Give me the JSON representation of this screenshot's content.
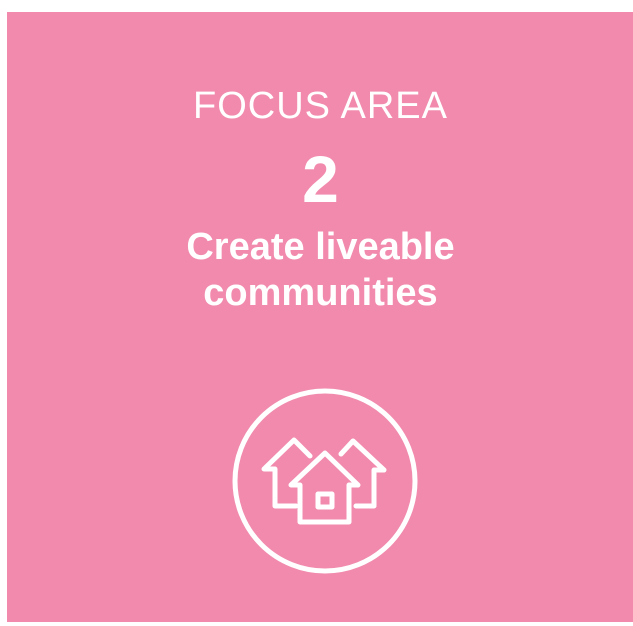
{
  "focus_area": {
    "eyebrow": "FOCUS AREA",
    "number": "2",
    "title_line1": "Create liveable",
    "title_line2": "communities"
  },
  "icon": {
    "name": "houses-icon"
  },
  "colors": {
    "background": "#f18aad",
    "foreground": "#ffffff"
  }
}
